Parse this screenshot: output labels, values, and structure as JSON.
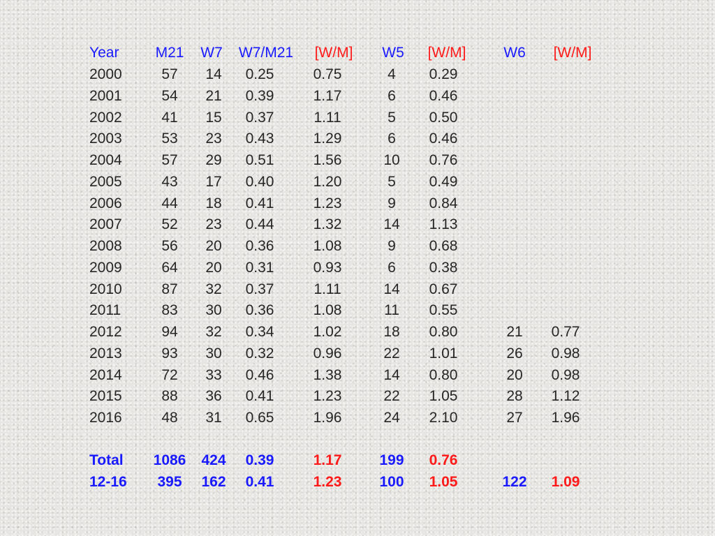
{
  "table": {
    "headers": [
      "Year",
      "M21",
      "W7",
      "W7/M21",
      "[W/M]",
      "W5",
      "[W/M]",
      "W6",
      "[W/M]"
    ],
    "rows": [
      [
        "2000",
        "57",
        "14",
        "0.25",
        "0.75",
        "4",
        "0.29",
        "",
        ""
      ],
      [
        "2001",
        "54",
        "21",
        "0.39",
        "1.17",
        "6",
        "0.46",
        "",
        ""
      ],
      [
        "2002",
        "41",
        "15",
        "0.37",
        "1.11",
        "5",
        "0.50",
        "",
        ""
      ],
      [
        "2003",
        "53",
        "23",
        "0.43",
        "1.29",
        "6",
        "0.46",
        "",
        ""
      ],
      [
        "2004",
        "57",
        "29",
        "0.51",
        "1.56",
        "10",
        "0.76",
        "",
        ""
      ],
      [
        "2005",
        "43",
        "17",
        "0.40",
        "1.20",
        "5",
        "0.49",
        "",
        ""
      ],
      [
        "2006",
        "44",
        "18",
        "0.41",
        "1.23",
        "9",
        "0.84",
        "",
        ""
      ],
      [
        "2007",
        "52",
        "23",
        "0.44",
        "1.32",
        "14",
        "1.13",
        "",
        ""
      ],
      [
        "2008",
        "56",
        "20",
        "0.36",
        "1.08",
        "9",
        "0.68",
        "",
        ""
      ],
      [
        "2009",
        "64",
        "20",
        "0.31",
        "0.93",
        "6",
        "0.38",
        "",
        ""
      ],
      [
        "2010",
        "87",
        "32",
        "0.37",
        "1.11",
        "14",
        "0.67",
        "",
        ""
      ],
      [
        "2011",
        "83",
        "30",
        "0.36",
        "1.08",
        "11",
        "0.55",
        "",
        ""
      ],
      [
        "2012",
        "94",
        "32",
        "0.34",
        "1.02",
        "18",
        "0.80",
        "21",
        "0.77"
      ],
      [
        "2013",
        "93",
        "30",
        "0.32",
        "0.96",
        "22",
        "1.01",
        "26",
        "0.98"
      ],
      [
        "2014",
        "72",
        "33",
        "0.46",
        "1.38",
        "14",
        "0.80",
        "20",
        "0.98"
      ],
      [
        "2015",
        "88",
        "36",
        "0.41",
        "1.23",
        "22",
        "1.05",
        "28",
        "1.12"
      ],
      [
        "2016",
        "48",
        "31",
        "0.65",
        "1.96",
        "24",
        "2.10",
        "27",
        "1.96"
      ]
    ],
    "totals": [
      [
        "Total",
        "1086",
        "424",
        "0.39",
        "1.17",
        "199",
        "0.76",
        "",
        ""
      ],
      [
        "12-16",
        "395",
        "162",
        "0.41",
        "1.23",
        "100",
        "1.05",
        "122",
        "1.09"
      ]
    ]
  },
  "colors": {
    "header_blue": "#1a1aff",
    "header_red": "#ff1a1a",
    "body_text": "#262626",
    "background": "#e6e5e1"
  }
}
